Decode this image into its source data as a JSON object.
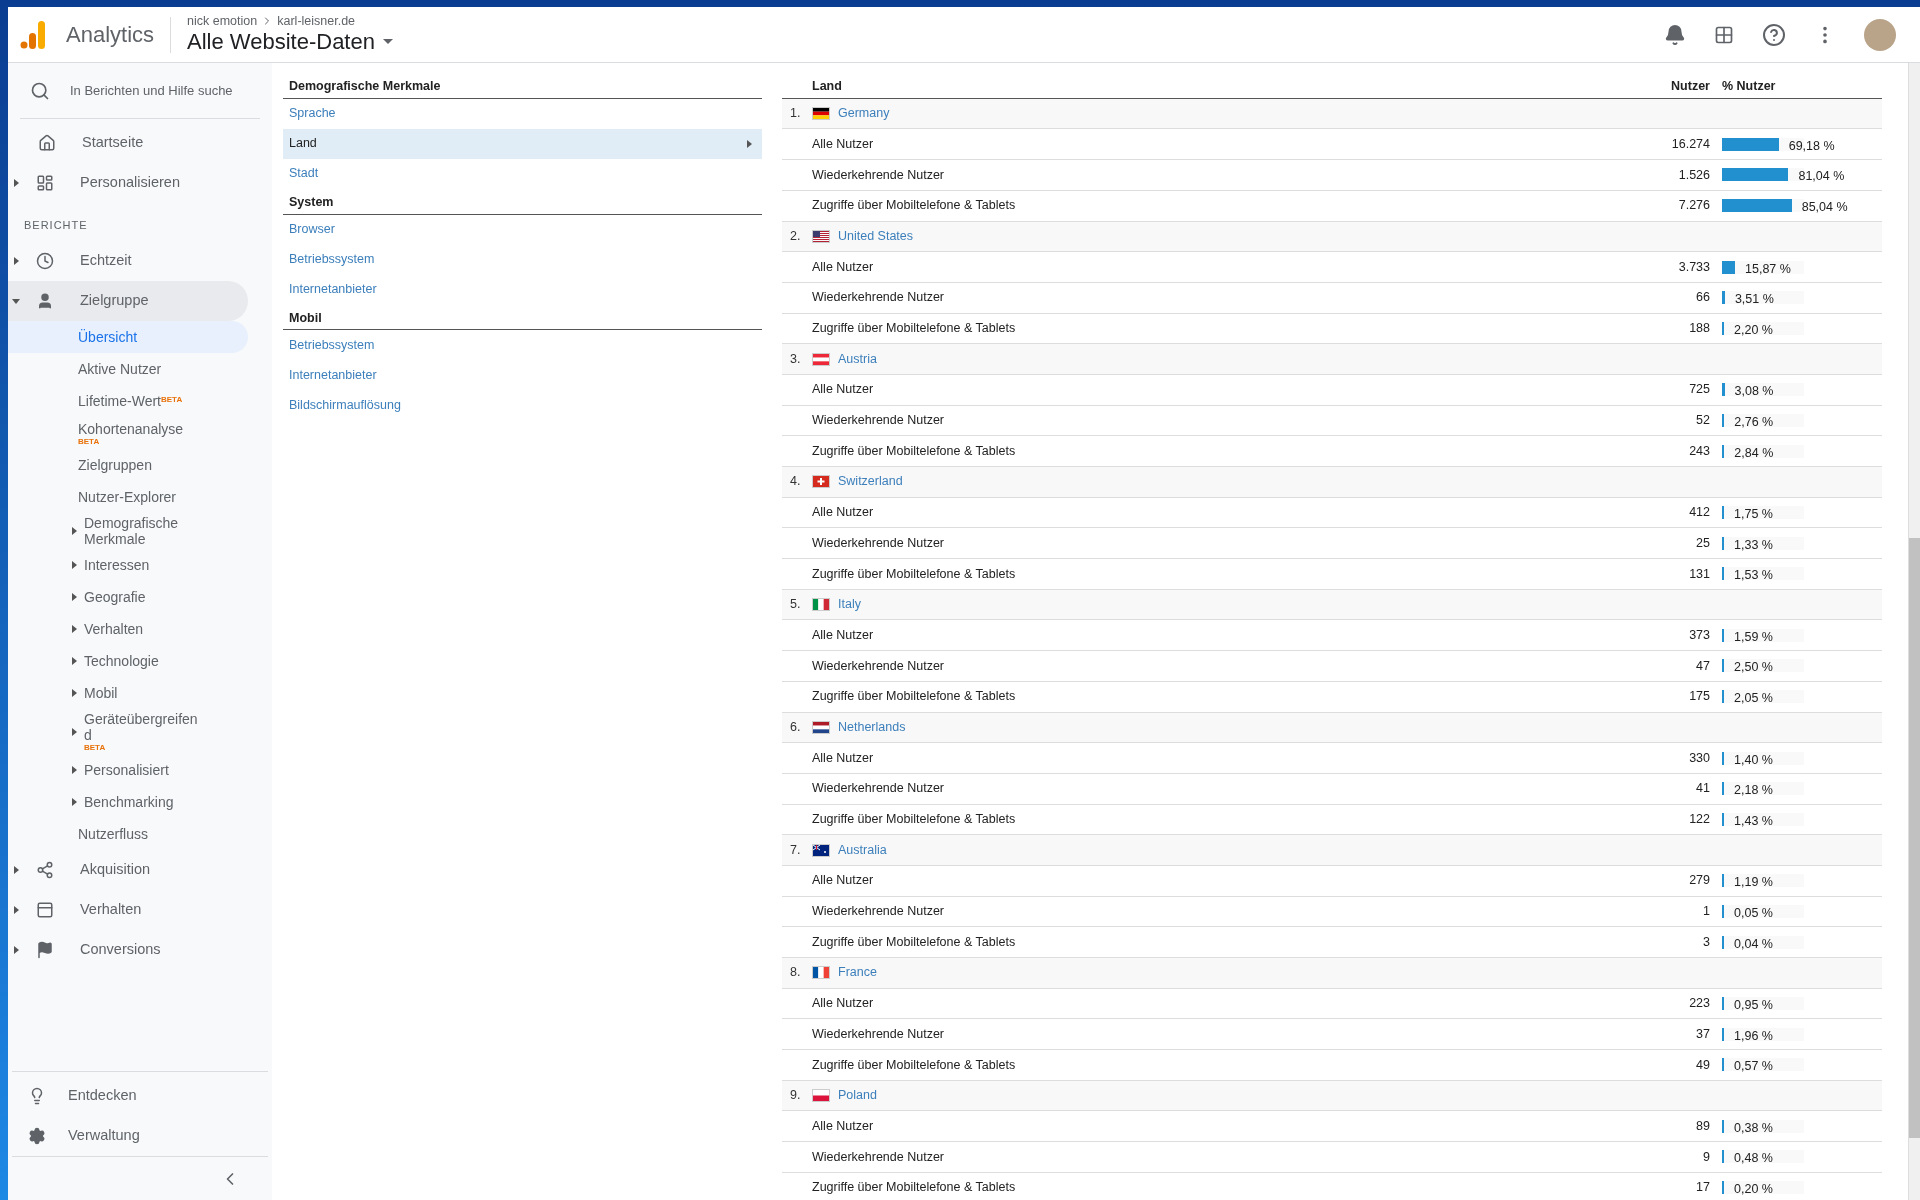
{
  "header": {
    "app_name": "Analytics",
    "breadcrumb": [
      "nick emotion",
      "karl-leisner.de"
    ],
    "view": "Alle Website-Daten"
  },
  "sidebar": {
    "search": {
      "placeholder": "In Berichten und Hilfe suche"
    },
    "top_items": [
      {
        "label": "Startseite"
      },
      {
        "label": "Personalisieren",
        "expanded": false
      }
    ],
    "section_label": "BERICHTE",
    "report_items": [
      {
        "label": "Echtzeit",
        "expanded": false,
        "selected": false
      },
      {
        "label": "Zielgruppe",
        "expanded": true,
        "selected": true,
        "children": [
          {
            "label": "Übersicht",
            "selected": true
          },
          {
            "label": "Aktive Nutzer",
            "selected": false
          },
          {
            "label": "Lifetime-Wert",
            "badge": "BETA",
            "kind": "superscript",
            "selected": false
          },
          {
            "label": "Kohortenanalyse",
            "badge": "BETA",
            "kind": "below",
            "selected": false
          },
          {
            "label": "Zielgruppen",
            "selected": false
          },
          {
            "label": "Nutzer-Explorer",
            "selected": false
          },
          {
            "label": "Demografische Merkmale",
            "expanded": false,
            "selected": false
          },
          {
            "label": "Interessen",
            "expanded": false,
            "selected": false
          },
          {
            "label": "Geografie",
            "expanded": false,
            "selected": false
          },
          {
            "label": "Verhalten",
            "expanded": false,
            "selected": false
          },
          {
            "label": "Technologie",
            "expanded": false,
            "selected": false
          },
          {
            "label": "Mobil",
            "expanded": false,
            "selected": false
          },
          {
            "label": "Geräteübergreifend",
            "badge": "BETA",
            "kind": "below",
            "expanded": false,
            "selected": false
          },
          {
            "label": "Personalisiert",
            "expanded": false,
            "selected": false
          },
          {
            "label": "Benchmarking",
            "expanded": false,
            "selected": false
          },
          {
            "label": "Nutzerfluss",
            "selected": false
          }
        ]
      },
      {
        "label": "Akquisition",
        "expanded": false,
        "selected": false
      },
      {
        "label": "Verhalten",
        "expanded": false,
        "selected": false
      },
      {
        "label": "Conversions",
        "expanded": false,
        "selected": false
      }
    ],
    "bottom_items": [
      {
        "label": "Entdecken"
      },
      {
        "label": "Verwaltung"
      }
    ]
  },
  "dimension_panel": [
    {
      "heading": "Demografische Merkmale",
      "items": [
        {
          "label": "Sprache",
          "selected": false
        },
        {
          "label": "Land",
          "selected": true
        },
        {
          "label": "Stadt",
          "selected": false
        }
      ]
    },
    {
      "heading": "System",
      "items": [
        {
          "label": "Browser",
          "selected": false
        },
        {
          "label": "Betriebssystem",
          "selected": false
        },
        {
          "label": "Internetanbieter",
          "selected": false
        }
      ]
    },
    {
      "heading": "Mobil",
      "items": [
        {
          "label": "Betriebssystem",
          "selected": false
        },
        {
          "label": "Internetanbieter",
          "selected": false
        },
        {
          "label": "Bildschirmauflösung",
          "selected": false
        }
      ]
    }
  ],
  "table": {
    "columns": [
      "Land",
      "Nutzer",
      "% Nutzer"
    ],
    "countries": [
      {
        "rank": "1.",
        "name": "Germany",
        "kind": "de",
        "rows": [
          {
            "label": "Alle Nutzer",
            "users": "16.274",
            "percent": "69,18 %",
            "level": 0.6918
          },
          {
            "label": "Wiederkehrende Nutzer",
            "users": "1.526",
            "percent": "81,04 %",
            "level": 0.8104
          },
          {
            "label": "Zugriffe über Mobiltelefone & Tablets",
            "users": "7.276",
            "percent": "85,04 %",
            "level": 0.8504
          }
        ]
      },
      {
        "rank": "2.",
        "name": "United States",
        "kind": "us",
        "rows": [
          {
            "label": "Alle Nutzer",
            "users": "3.733",
            "percent": "15,87 %",
            "level": 0.1587
          },
          {
            "label": "Wiederkehrende Nutzer",
            "users": "66",
            "percent": "3,51 %",
            "level": 0.0351
          },
          {
            "label": "Zugriffe über Mobiltelefone & Tablets",
            "users": "188",
            "percent": "2,20 %",
            "level": 0.022
          }
        ]
      },
      {
        "rank": "3.",
        "name": "Austria",
        "kind": "at",
        "rows": [
          {
            "label": "Alle Nutzer",
            "users": "725",
            "percent": "3,08 %",
            "level": 0.0308
          },
          {
            "label": "Wiederkehrende Nutzer",
            "users": "52",
            "percent": "2,76 %",
            "level": 0.0276
          },
          {
            "label": "Zugriffe über Mobiltelefone & Tablets",
            "users": "243",
            "percent": "2,84 %",
            "level": 0.0284
          }
        ]
      },
      {
        "rank": "4.",
        "name": "Switzerland",
        "kind": "ch",
        "rows": [
          {
            "label": "Alle Nutzer",
            "users": "412",
            "percent": "1,75 %",
            "level": 0.0175
          },
          {
            "label": "Wiederkehrende Nutzer",
            "users": "25",
            "percent": "1,33 %",
            "level": 0.0133
          },
          {
            "label": "Zugriffe über Mobiltelefone & Tablets",
            "users": "131",
            "percent": "1,53 %",
            "level": 0.0153
          }
        ]
      },
      {
        "rank": "5.",
        "name": "Italy",
        "kind": "it",
        "rows": [
          {
            "label": "Alle Nutzer",
            "users": "373",
            "percent": "1,59 %",
            "level": 0.0159
          },
          {
            "label": "Wiederkehrende Nutzer",
            "users": "47",
            "percent": "2,50 %",
            "level": 0.025
          },
          {
            "label": "Zugriffe über Mobiltelefone & Tablets",
            "users": "175",
            "percent": "2,05 %",
            "level": 0.0205
          }
        ]
      },
      {
        "rank": "6.",
        "name": "Netherlands",
        "kind": "nl",
        "rows": [
          {
            "label": "Alle Nutzer",
            "users": "330",
            "percent": "1,40 %",
            "level": 0.014
          },
          {
            "label": "Wiederkehrende Nutzer",
            "users": "41",
            "percent": "2,18 %",
            "level": 0.0218
          },
          {
            "label": "Zugriffe über Mobiltelefone & Tablets",
            "users": "122",
            "percent": "1,43 %",
            "level": 0.0143
          }
        ]
      },
      {
        "rank": "7.",
        "name": "Australia",
        "kind": "au",
        "rows": [
          {
            "label": "Alle Nutzer",
            "users": "279",
            "percent": "1,19 %",
            "level": 0.0119
          },
          {
            "label": "Wiederkehrende Nutzer",
            "users": "1",
            "percent": "0,05 %",
            "level": 0.0005
          },
          {
            "label": "Zugriffe über Mobiltelefone & Tablets",
            "users": "3",
            "percent": "0,04 %",
            "level": 0.0004
          }
        ]
      },
      {
        "rank": "8.",
        "name": "France",
        "kind": "fr",
        "rows": [
          {
            "label": "Alle Nutzer",
            "users": "223",
            "percent": "0,95 %",
            "level": 0.0095
          },
          {
            "label": "Wiederkehrende Nutzer",
            "users": "37",
            "percent": "1,96 %",
            "level": 0.0196
          },
          {
            "label": "Zugriffe über Mobiltelefone & Tablets",
            "users": "49",
            "percent": "0,57 %",
            "level": 0.0057
          }
        ]
      },
      {
        "rank": "9.",
        "name": "Poland",
        "kind": "pl",
        "rows": [
          {
            "label": "Alle Nutzer",
            "users": "89",
            "percent": "0,38 %",
            "level": 0.0038
          },
          {
            "label": "Wiederkehrende Nutzer",
            "users": "9",
            "percent": "0,48 %",
            "level": 0.0048
          },
          {
            "label": "Zugriffe über Mobiltelefone & Tablets",
            "users": "17",
            "percent": "0,20 %",
            "level": 0.002
          }
        ]
      }
    ]
  }
}
